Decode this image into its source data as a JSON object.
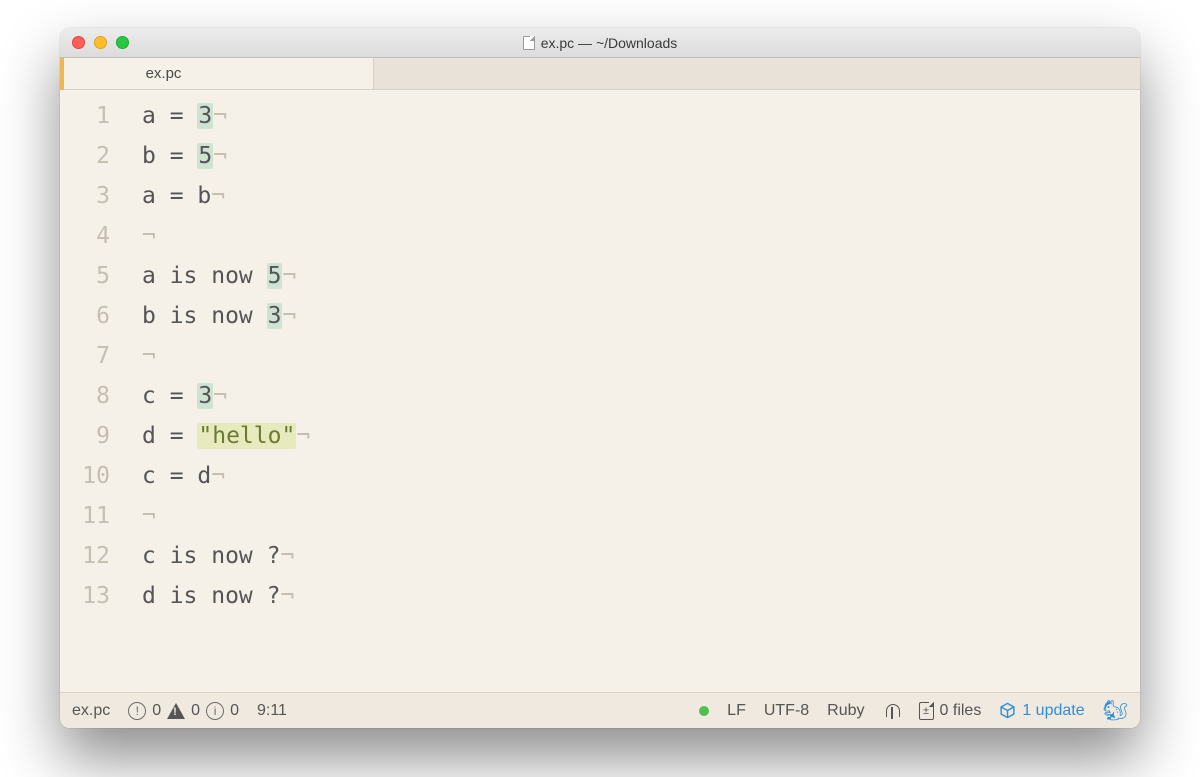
{
  "window": {
    "title": "ex.pc — ~/Downloads"
  },
  "tabs": [
    {
      "label": "ex.pc",
      "active": true
    }
  ],
  "editor": {
    "lines": [
      {
        "n": 1,
        "pre": "a = ",
        "hl": "3",
        "hlType": "num",
        "post": ""
      },
      {
        "n": 2,
        "pre": "b = ",
        "hl": "5",
        "hlType": "num",
        "post": ""
      },
      {
        "n": 3,
        "pre": "a = b",
        "hl": "",
        "hlType": "",
        "post": ""
      },
      {
        "n": 4,
        "pre": "",
        "hl": "",
        "hlType": "",
        "post": ""
      },
      {
        "n": 5,
        "pre": "a is now ",
        "hl": "5",
        "hlType": "num",
        "post": ""
      },
      {
        "n": 6,
        "pre": "b is now ",
        "hl": "3",
        "hlType": "num",
        "post": ""
      },
      {
        "n": 7,
        "pre": "",
        "hl": "",
        "hlType": "",
        "post": ""
      },
      {
        "n": 8,
        "pre": "c = ",
        "hl": "3",
        "hlType": "num",
        "post": ""
      },
      {
        "n": 9,
        "pre": "d = ",
        "hl": "\"hello\"",
        "hlType": "str",
        "post": ""
      },
      {
        "n": 10,
        "pre": "c = d",
        "hl": "",
        "hlType": "",
        "post": ""
      },
      {
        "n": 11,
        "pre": "",
        "hl": "",
        "hlType": "",
        "post": ""
      },
      {
        "n": 12,
        "pre": "c is now ?",
        "hl": "",
        "hlType": "",
        "post": ""
      },
      {
        "n": 13,
        "pre": "d is now ?",
        "hl": "",
        "hlType": "",
        "post": ""
      }
    ],
    "eol_glyph": "¬"
  },
  "status": {
    "filename": "ex.pc",
    "errors": "0",
    "warnings": "0",
    "info": "0",
    "cursor": "9:11",
    "line_ending": "LF",
    "encoding": "UTF-8",
    "grammar": "Ruby",
    "git_files": "0 files",
    "diff_symbol": "±",
    "updates": "1 update"
  }
}
